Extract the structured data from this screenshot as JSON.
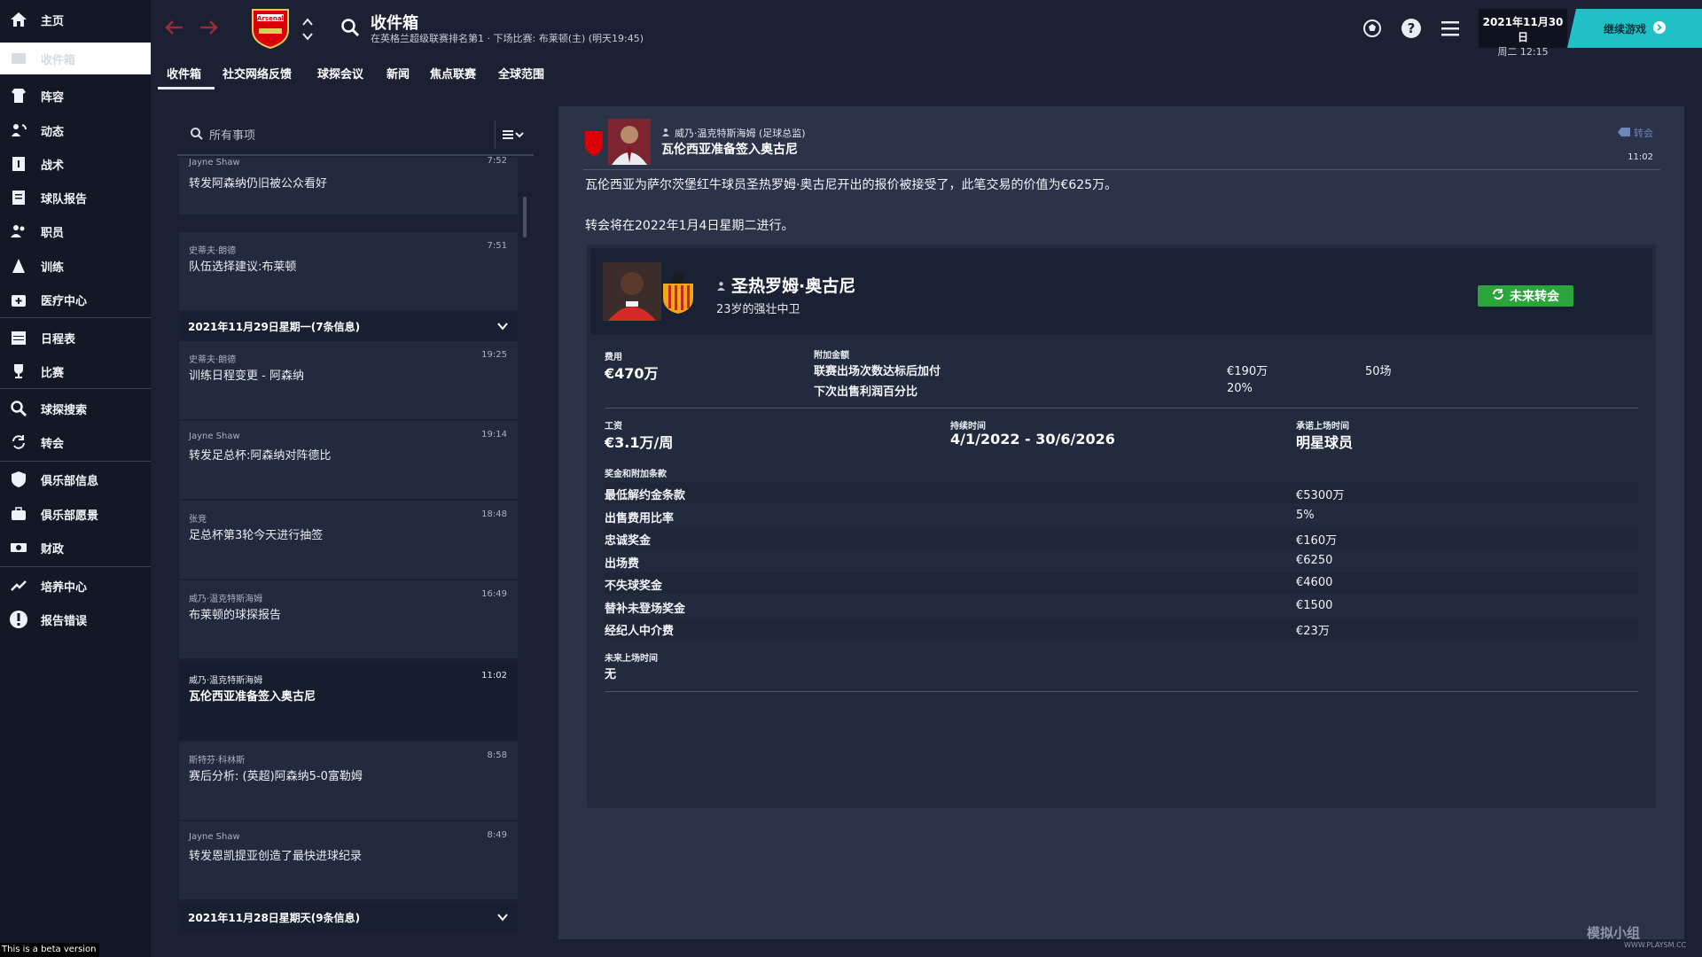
{
  "sidebar": {
    "items": [
      {
        "label": "主页",
        "icon": "home-icon"
      },
      {
        "label": "收件箱",
        "icon": "inbox-icon"
      },
      {
        "label": "阵容",
        "icon": "squad-icon"
      },
      {
        "label": "动态",
        "icon": "dynamics-icon"
      },
      {
        "label": "战术",
        "icon": "tactics-icon"
      },
      {
        "label": "球队报告",
        "icon": "report-icon"
      },
      {
        "label": "职员",
        "icon": "staff-icon"
      },
      {
        "label": "训练",
        "icon": "training-icon"
      },
      {
        "label": "医疗中心",
        "icon": "medical-icon"
      },
      {
        "label": "日程表",
        "icon": "calendar-icon"
      },
      {
        "label": "比赛",
        "icon": "trophy-icon"
      },
      {
        "label": "球探搜索",
        "icon": "scout-search-icon"
      },
      {
        "label": "转会",
        "icon": "transfer-icon"
      },
      {
        "label": "俱乐部信息",
        "icon": "shield-icon"
      },
      {
        "label": "俱乐部愿景",
        "icon": "vision-icon"
      },
      {
        "label": "财政",
        "icon": "money-icon"
      },
      {
        "label": "培养中心",
        "icon": "development-icon"
      },
      {
        "label": "报告错误",
        "icon": "error-icon"
      }
    ]
  },
  "header": {
    "title": "收件箱",
    "subtitle": "在英格兰超级联赛排名第1 · 下场比赛: 布莱顿(主) (明天19:45)",
    "club": "Arsenal",
    "date": "2021年11月30日",
    "day_time": "周二 12:15",
    "continue_label": "继续游戏"
  },
  "tabs": [
    "收件箱",
    "社交网络反馈",
    "球探会议",
    "新闻",
    "焦点联赛",
    "全球范围"
  ],
  "inbox": {
    "search_placeholder": "所有事项",
    "top_partial": {
      "from": "Jayne Shaw",
      "subject": "转发阿森纳仍旧被公众看好",
      "time": "7:52"
    },
    "messages_a": [
      {
        "from": "史蒂夫·朗德",
        "subject": "队伍选择建议:布莱顿",
        "time": "7:51"
      }
    ],
    "group1": "2021年11月29日星期一(7条信息)",
    "messages_b": [
      {
        "from": "史蒂夫·朗德",
        "subject": "训练日程变更 - 阿森纳",
        "time": "19:25"
      },
      {
        "from": "Jayne Shaw",
        "subject": "转发足总杯:阿森纳对阵德比",
        "time": "19:14"
      },
      {
        "from": "张竞",
        "subject": "足总杯第3轮今天进行抽签",
        "time": "18:48"
      },
      {
        "from": "威乃·温克特斯海姆",
        "subject": "布莱顿的球探报告",
        "time": "16:49"
      },
      {
        "from": "威乃·温克特斯海姆",
        "subject": "瓦伦西亚准备签入奥古尼",
        "time": "11:02"
      },
      {
        "from": "斯特芬·科林斯",
        "subject": "赛后分析: (英超)阿森纳5-0富勒姆",
        "time": "8:58"
      },
      {
        "from": "Jayne Shaw",
        "subject": "转发恩凯提亚创造了最快进球纪录",
        "time": "8:49"
      }
    ],
    "group2": "2021年11月28日星期天(9条信息)"
  },
  "detail": {
    "from": "威乃·温克特斯海姆 (足球总监)",
    "subject": "瓦伦西亚准备签入奥古尼",
    "tag": "转会",
    "time": "11:02",
    "body1": "瓦伦西亚为萨尔茨堡红牛球员圣热罗姆·奥古尼开出的报价被接受了，此笔交易的价值为€625万。",
    "body2": "转会将在2022年1月4日星期二进行。",
    "player_name": "圣热罗姆·奥古尼",
    "player_desc": "23岁的强壮中卫",
    "status_badge": "未来转会",
    "fee_label": "费用",
    "fee_value": "€470万",
    "addons_label": "附加金额",
    "addons": [
      {
        "name": "联赛出场次数达标后加付",
        "amount": "€190万",
        "cond": "50场"
      },
      {
        "name": "下次出售利润百分比",
        "amount": "20%",
        "cond": ""
      }
    ],
    "wage_label": "工资",
    "wage_value": "€3.1万/周",
    "duration_label": "持续时间",
    "duration_value": "4/1/2022 - 30/6/2026",
    "playing_time_label": "承诺上场时间",
    "playing_time_value": "明星球员",
    "bonuses_label": "奖金和附加条款",
    "bonuses": [
      {
        "name": "最低解约金条款",
        "value": "€5300万"
      },
      {
        "name": "出售费用比率",
        "value": "5%"
      },
      {
        "name": "忠诚奖金",
        "value": "€160万"
      },
      {
        "name": "出场费",
        "value": "€6250"
      },
      {
        "name": "不失球奖金",
        "value": "€4600"
      },
      {
        "name": "替补未登场奖金",
        "value": "€1500"
      },
      {
        "name": "经纪人中介费",
        "value": "€23万"
      }
    ],
    "future_time_label": "未来上场时间",
    "future_time_value": "无"
  },
  "beta_note": "This is a beta version",
  "watermark": "模拟小组",
  "watermark_url": "WWW.PLAYSM.CC",
  "colors": {
    "accent_teal": "#1fc1c6",
    "badge_green": "#2aa53c",
    "arsenal_red": "#db0007"
  }
}
